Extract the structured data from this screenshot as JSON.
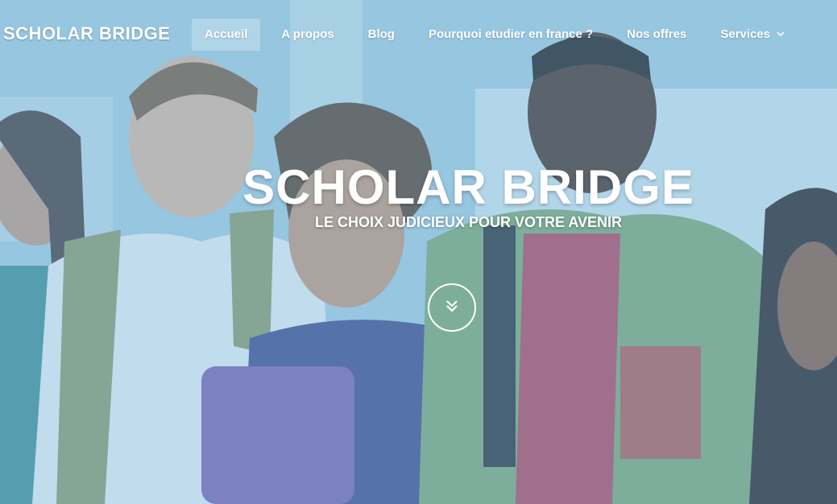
{
  "brand": "SCHOLAR BRIDGE",
  "nav": {
    "items": [
      {
        "label": "Accueil",
        "active": true
      },
      {
        "label": "A propos",
        "active": false
      },
      {
        "label": "Blog",
        "active": false
      },
      {
        "label": "Pourquoi etudier en france ?",
        "active": false
      },
      {
        "label": "Nos offres",
        "active": false
      },
      {
        "label": "Services",
        "active": false,
        "has_dropdown": true
      }
    ]
  },
  "hero": {
    "title": "SCHOLAR BRIDGE",
    "subtitle": "LE CHOIX JUDICIEUX POUR VOTRE AVENIR",
    "scroll_icon": "double-chevron-down-icon"
  },
  "colors": {
    "overlay": "#78b9dc",
    "text": "#ffffff"
  }
}
